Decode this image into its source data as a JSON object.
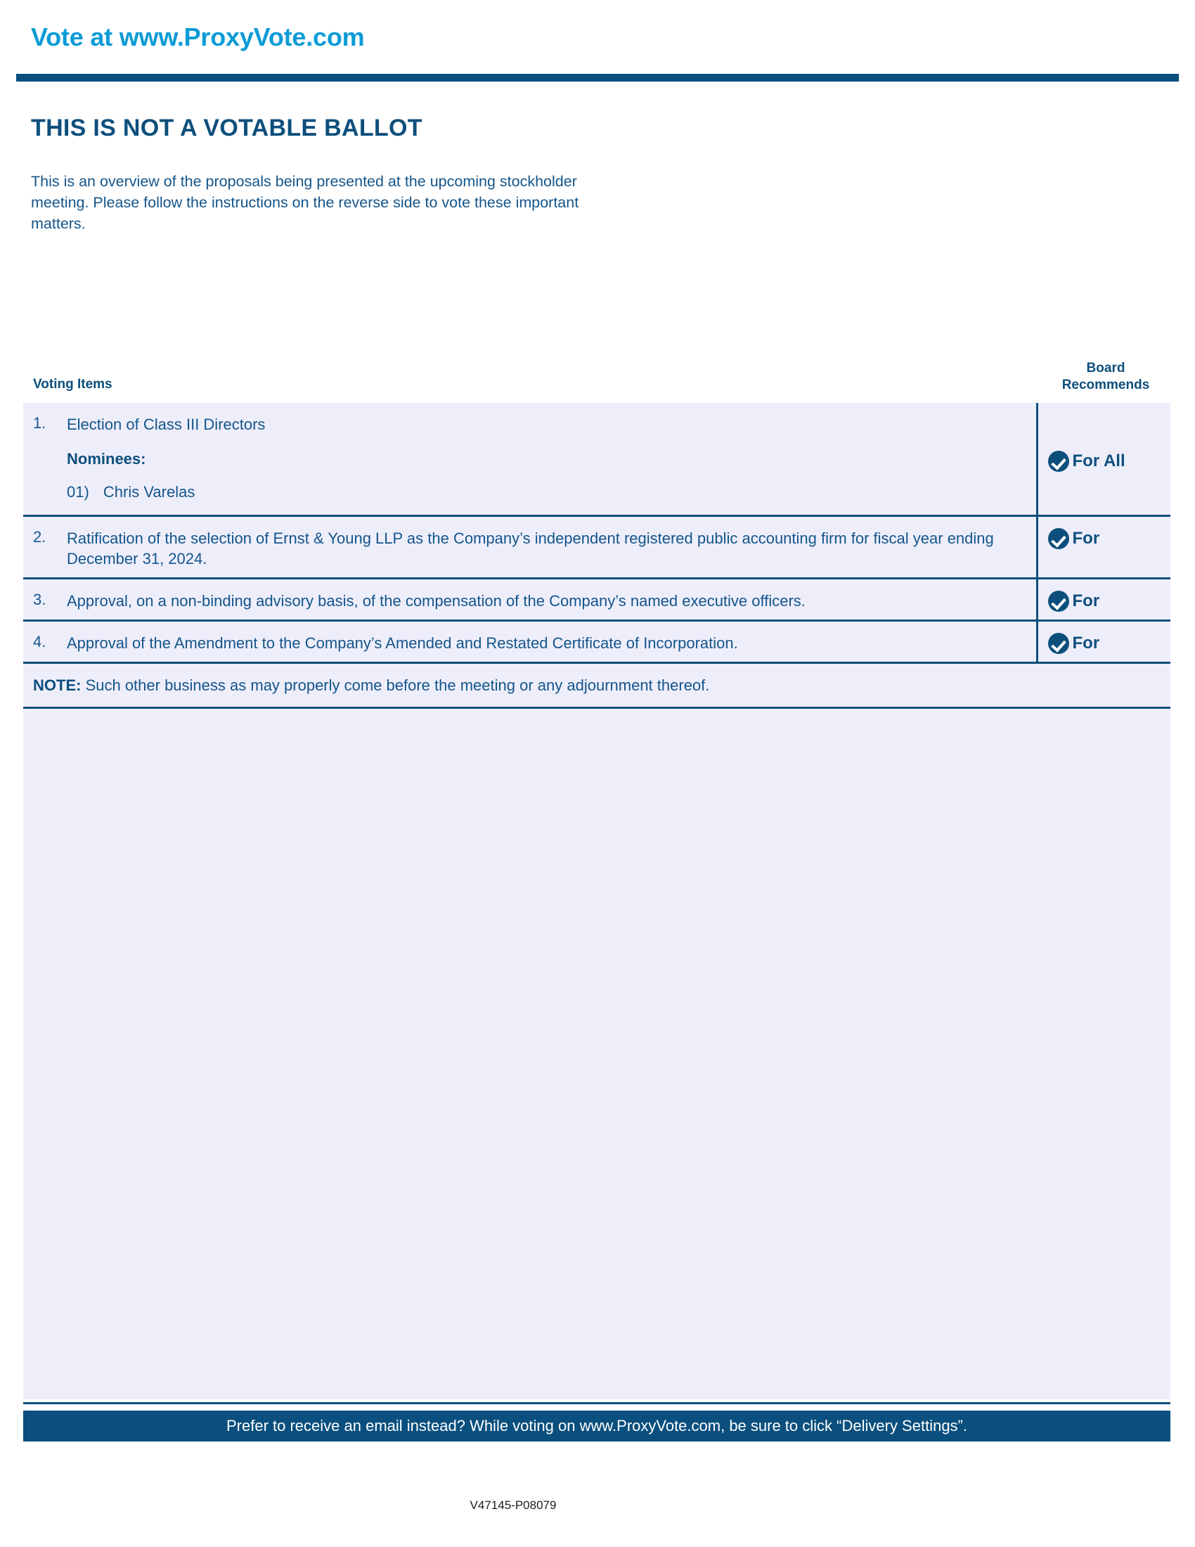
{
  "header": {
    "masthead": "Vote at www.ProxyVote.com"
  },
  "intro": {
    "headline": "THIS IS NOT A VOTABLE BALLOT",
    "paragraph": "This is an overview of the proposals being presented at the upcoming stockholder meeting. Please follow the instructions on the reverse side to vote these important matters."
  },
  "table": {
    "col_items_header": "Voting Items",
    "col_board_header_line1": "Board",
    "col_board_header_line2": "Recommends",
    "rows": [
      {
        "number": "1.",
        "text": "Election of Class III Directors",
        "nominees_label": "Nominees:",
        "nominees": [
          {
            "index": "01)",
            "name": "Chris Varelas"
          }
        ],
        "recommendation": "For All"
      },
      {
        "number": "2.",
        "text": "Ratification of the selection of Ernst & Young LLP as the Company’s independent registered public accounting firm for fiscal year ending December 31, 2024.",
        "recommendation": "For"
      },
      {
        "number": "3.",
        "text": "Approval, on a non-binding advisory basis, of the compensation of the Company’s named executive officers.",
        "recommendation": "For"
      },
      {
        "number": "4.",
        "text": "Approval of the Amendment to the Company’s Amended and Restated Certificate of Incorporation.",
        "recommendation": "For"
      }
    ],
    "note_label": "NOTE:",
    "note_text": "Such other business as may properly come before the meeting or any adjournment thereof."
  },
  "footer": {
    "message": "Prefer to receive an email instead? While voting on www.ProxyVote.com, be sure to click “Delivery Settings”.",
    "document_code": "V47145-P08079"
  },
  "colors": {
    "brand_cyan": "#0c9bd6",
    "brand_navy": "#0d4f7c",
    "panel_bg": "#eeeefb",
    "body_text": "#14558a"
  }
}
